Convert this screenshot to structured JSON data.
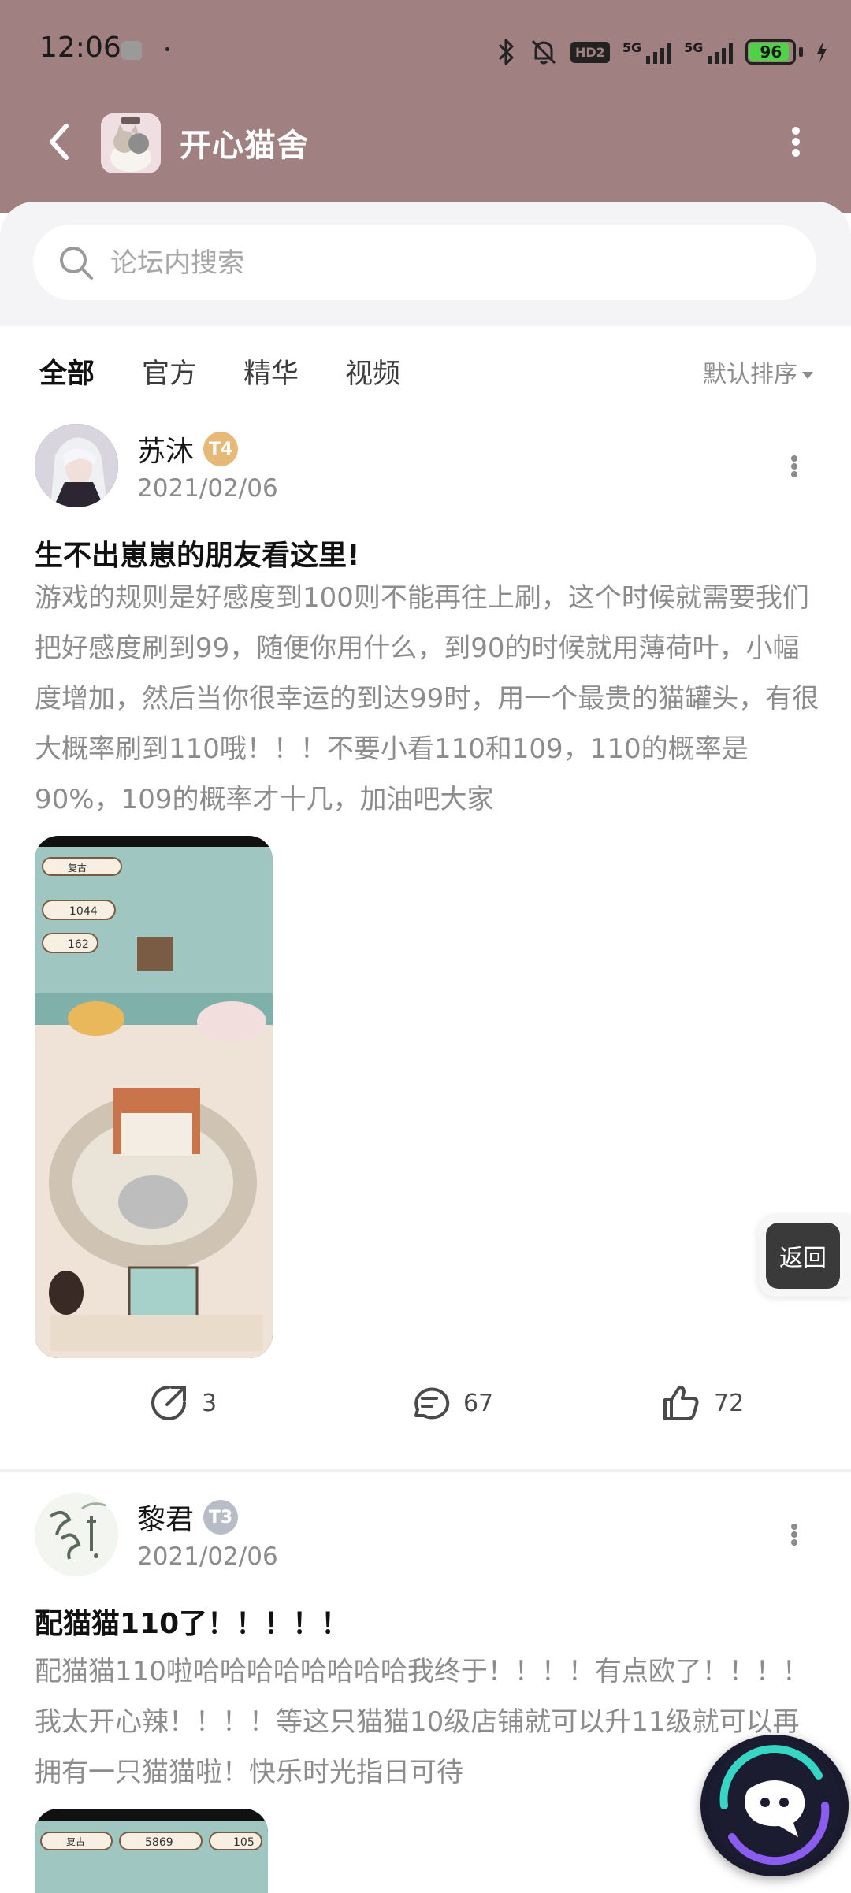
{
  "status_bar": {
    "time": "12:06",
    "hd": "HD2",
    "network_1": "5G",
    "network_2": "5G",
    "battery": "96"
  },
  "header": {
    "title": "开心猫舍",
    "back_icon": "chevron-left-icon",
    "more_icon": "vertical-dots-icon"
  },
  "search": {
    "placeholder": "论坛内搜索",
    "icon": "search-icon"
  },
  "tabs": [
    {
      "label": "全部",
      "active": true
    },
    {
      "label": "官方",
      "active": false
    },
    {
      "label": "精华",
      "active": false
    },
    {
      "label": "视频",
      "active": false
    }
  ],
  "sort": {
    "label": "默认排序"
  },
  "posts": [
    {
      "author": "苏沐",
      "level": "T4",
      "date": "2021/02/06",
      "title": "生不出崽崽的朋友看这里!",
      "body": "游戏的规则是好感度到100则不能再往上刷，这个时候就需要我们把好感度刷到99，随便你用什么，到90的时候就用薄荷叶，小幅度增加，然后当你很幸运的到达99时，用一个最贵的猫罐头，有很大概率刷到110哦！！！不要小看110和109，110的概率是90%，109的概率才十几，加油吧大家",
      "image_labels": {
        "name": "复古",
        "fish": "1044",
        "coins": "162"
      },
      "shares": "3",
      "comments": "67",
      "likes": "72"
    },
    {
      "author": "黎君",
      "level": "T3",
      "date": "2021/02/06",
      "title": "配猫猫110了！！！！！",
      "body": "配猫猫110啦哈哈哈哈哈哈哈哈我终于！！！！有点欧了！！！！我太开心辣！！！！等这只猫猫10级店铺就可以升11级就可以再拥有一只猫猫啦！快乐时光指日可待",
      "image_labels": {
        "name": "复古",
        "fish": "5869",
        "coins": "105"
      }
    }
  ],
  "float_back": {
    "label": "返回"
  },
  "colors": {
    "header_bg": "#a08081",
    "tab_accent": "#47c6c0",
    "gold_badge": "#e6b978",
    "silver_badge": "#b7bcc6"
  }
}
